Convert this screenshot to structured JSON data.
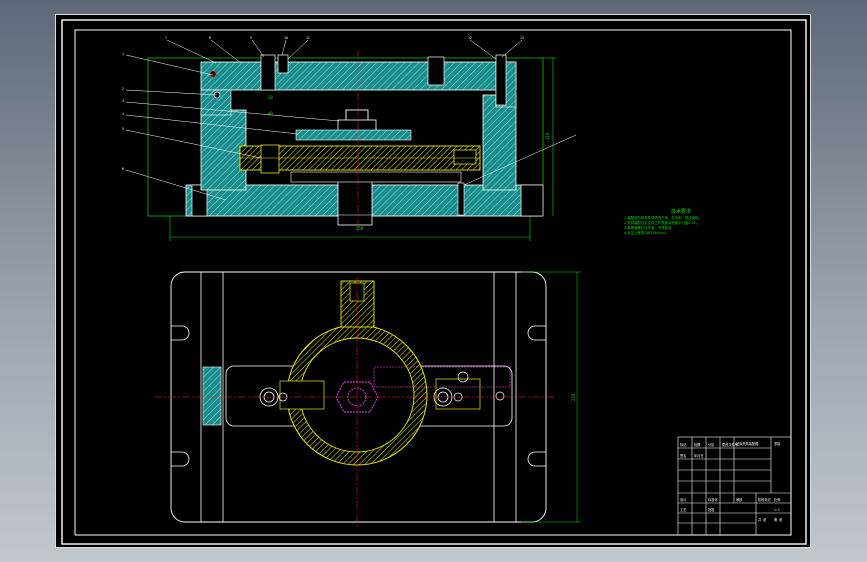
{
  "viewport": {
    "background": "#000000",
    "frame_color": "#ffffff"
  },
  "colors": {
    "outline": "#ffffff",
    "hatch": "#2fbfbf",
    "center": "#ff2020",
    "part_yellow": "#e8e800",
    "dimension": "#00e000",
    "hidden": "#ff40ff"
  },
  "balloons": [
    "1",
    "2",
    "3",
    "4",
    "5",
    "6",
    "7",
    "8",
    "9",
    "10",
    "11",
    "12",
    "13"
  ],
  "dimensions": {
    "top_width": "250",
    "sub_a": "28",
    "sub_b": "40",
    "right_height": "110",
    "plan_height": "210"
  },
  "notes": {
    "title": "技术要求",
    "lines": [
      "1.装配前所有零件须清洗干净，去毛刺、锐边倒钝。",
      "2.夹具装配后定位件工作表面对底面平行度0.02。",
      "3.各紧固螺钉应拧紧，不得松动。",
      "4.未注公差按GB/T1804-m。"
    ]
  },
  "title_block": {
    "drawing_title": "钻床夹具装配图",
    "labels": [
      "标记",
      "处数",
      "分区",
      "更改文件号",
      "签名",
      "年月日",
      "设计",
      "标准化",
      "审核",
      "工艺",
      "批准",
      "阶段标记",
      "重量",
      "比例",
      "共 张",
      "第 张"
    ],
    "scale": "1:1"
  }
}
